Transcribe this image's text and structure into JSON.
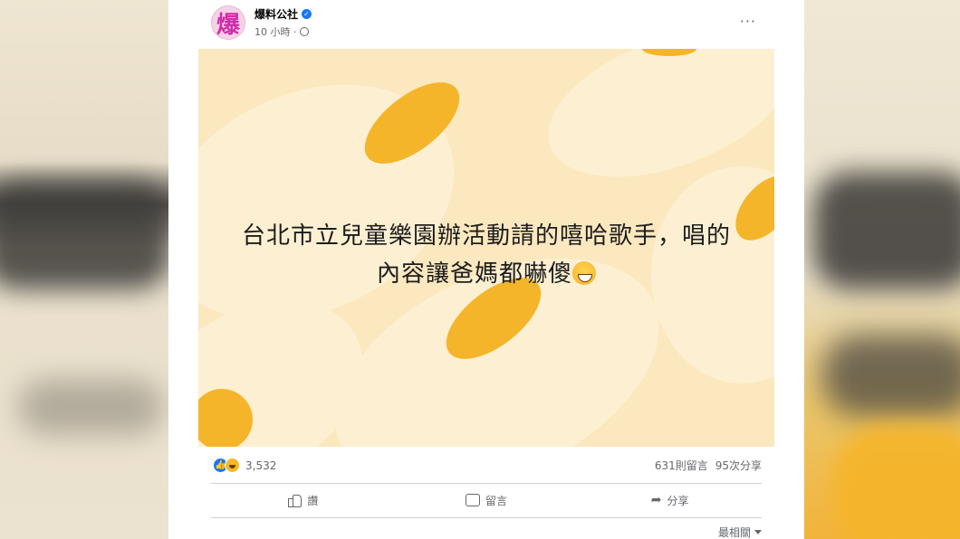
{
  "post": {
    "page_name": "爆料公社",
    "avatar_char": "爆",
    "time": "10 小時 ·",
    "more": "···",
    "text_line1": "台北市立兒童樂園辦活動請的嘻哈歌手，唱的",
    "text_line2": "內容讓爸媽都嚇傻",
    "emoji": "sweat-smile-emoji"
  },
  "stats": {
    "reaction_count": "3,532",
    "comments": "631則留言",
    "shares": "95次分享"
  },
  "actions": {
    "like": "讚",
    "comment": "留言",
    "share": "分享"
  },
  "sort": {
    "label": "最相關"
  },
  "icons": {
    "verified": "verified-badge-icon",
    "globe": "globe-icon",
    "like": "like-reaction-icon",
    "haha": "haha-reaction-icon"
  },
  "colors": {
    "accent": "#1877f2",
    "media_bg": "#fbe8bf",
    "blob": "#f5b52a"
  }
}
